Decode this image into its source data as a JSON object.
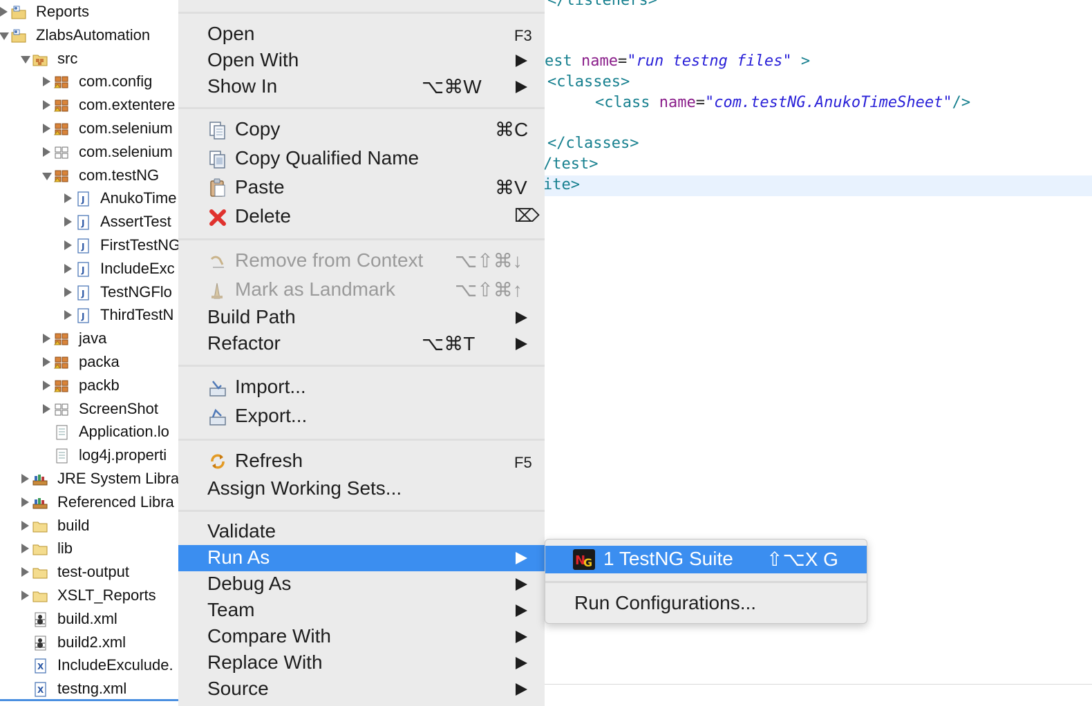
{
  "tree": [
    {
      "label": "Reports",
      "icon": "project-icon",
      "twisty": "closed"
    },
    {
      "label": "ZlabsAutomation",
      "icon": "project-icon",
      "twisty": "open"
    },
    {
      "label": "src",
      "icon": "source-folder-icon",
      "twisty": "open"
    },
    {
      "label": "com.config",
      "icon": "package-icon",
      "twisty": "closed"
    },
    {
      "label": "com.extentere",
      "icon": "package-icon",
      "twisty": "closed"
    },
    {
      "label": "com.selenium",
      "icon": "package-icon",
      "twisty": "closed"
    },
    {
      "label": "com.selenium",
      "icon": "empty-package-icon",
      "twisty": "closed"
    },
    {
      "label": "com.testNG",
      "icon": "package-icon",
      "twisty": "open"
    },
    {
      "label": "AnukoTime",
      "icon": "java-file-icon",
      "twisty": "closed"
    },
    {
      "label": "AssertTest",
      "icon": "java-file-icon",
      "twisty": "closed"
    },
    {
      "label": "FirstTestNG",
      "icon": "java-file-icon",
      "twisty": "closed"
    },
    {
      "label": "IncludeExc",
      "icon": "java-file-icon",
      "twisty": "closed"
    },
    {
      "label": "TestNGFlo",
      "icon": "java-file-icon",
      "twisty": "closed"
    },
    {
      "label": "ThirdTestN",
      "icon": "java-file-icon",
      "twisty": "closed"
    },
    {
      "label": "java",
      "icon": "package-icon",
      "twisty": "closed"
    },
    {
      "label": "packa",
      "icon": "package-icon",
      "twisty": "closed"
    },
    {
      "label": "packb",
      "icon": "package-icon",
      "twisty": "closed"
    },
    {
      "label": "ScreenShot",
      "icon": "empty-package-icon",
      "twisty": "closed"
    },
    {
      "label": "Application.lo",
      "icon": "text-file-icon",
      "twisty": "none"
    },
    {
      "label": "log4j.properti",
      "icon": "text-file-icon",
      "twisty": "none"
    },
    {
      "label": "JRE System Libra",
      "icon": "library-icon",
      "twisty": "closed"
    },
    {
      "label": "Referenced Libra",
      "icon": "library-icon",
      "twisty": "closed"
    },
    {
      "label": "build",
      "icon": "folder-icon",
      "twisty": "closed"
    },
    {
      "label": "lib",
      "icon": "folder-icon",
      "twisty": "closed"
    },
    {
      "label": "test-output",
      "icon": "folder-icon",
      "twisty": "closed"
    },
    {
      "label": "XSLT_Reports",
      "icon": "folder-icon",
      "twisty": "closed"
    },
    {
      "label": "build.xml",
      "icon": "ant-file-icon",
      "twisty": "none"
    },
    {
      "label": "build2.xml",
      "icon": "ant-file-icon",
      "twisty": "none"
    },
    {
      "label": "IncludeExculude.",
      "icon": "xml-file-icon",
      "twisty": "none"
    },
    {
      "label": "testng.xml",
      "icon": "xml-file-icon",
      "twisty": "none"
    }
  ],
  "editor": {
    "line_top": "</listeners>",
    "line1_tag": "est ",
    "line1_attr": "name",
    "line1_eq": "=",
    "line1_str": "\"run testng files\"",
    "line1_end": " >",
    "line2": "<classes>",
    "line3_tag": "<class ",
    "line3_attr": "name",
    "line3_eq": "=",
    "line3_str": "\"com.testNG.AnukoTimeSheet\"",
    "line3_end": "/>",
    "line4": "</classes>",
    "line5": "/test>",
    "line6": "ite>"
  },
  "menu": {
    "open": "Open",
    "open_sc": "F3",
    "open_with": "Open With",
    "show_in": "Show In",
    "show_in_sc": "⌥⌘W",
    "copy": "Copy",
    "copy_sc": "⌘C",
    "copy_qualified": "Copy Qualified Name",
    "paste": "Paste",
    "paste_sc": "⌘V",
    "delete": "Delete",
    "delete_sc": "⌦",
    "remove_context": "Remove from Context",
    "remove_context_sc": "⌥⇧⌘↓",
    "mark_landmark": "Mark as Landmark",
    "mark_landmark_sc": "⌥⇧⌘↑",
    "build_path": "Build Path",
    "refactor": "Refactor",
    "refactor_sc": "⌥⌘T",
    "import": "Import...",
    "export": "Export...",
    "refresh": "Refresh",
    "refresh_sc": "F5",
    "assign_ws": "Assign Working Sets...",
    "validate": "Validate",
    "run_as": "Run As",
    "debug_as": "Debug As",
    "team": "Team",
    "compare_with": "Compare With",
    "replace_with": "Replace With",
    "source": "Source"
  },
  "submenu": {
    "testng_suite": "1 TestNG Suite",
    "testng_suite_sc": "⇧⌥X G",
    "run_configs": "Run Configurations..."
  },
  "colors": {
    "highlight": "#3b8ef0",
    "menu_bg": "#ebebeb",
    "xml_tag": "#17808f",
    "xml_attr": "#8a1e8a",
    "xml_string": "#2a21d8"
  }
}
